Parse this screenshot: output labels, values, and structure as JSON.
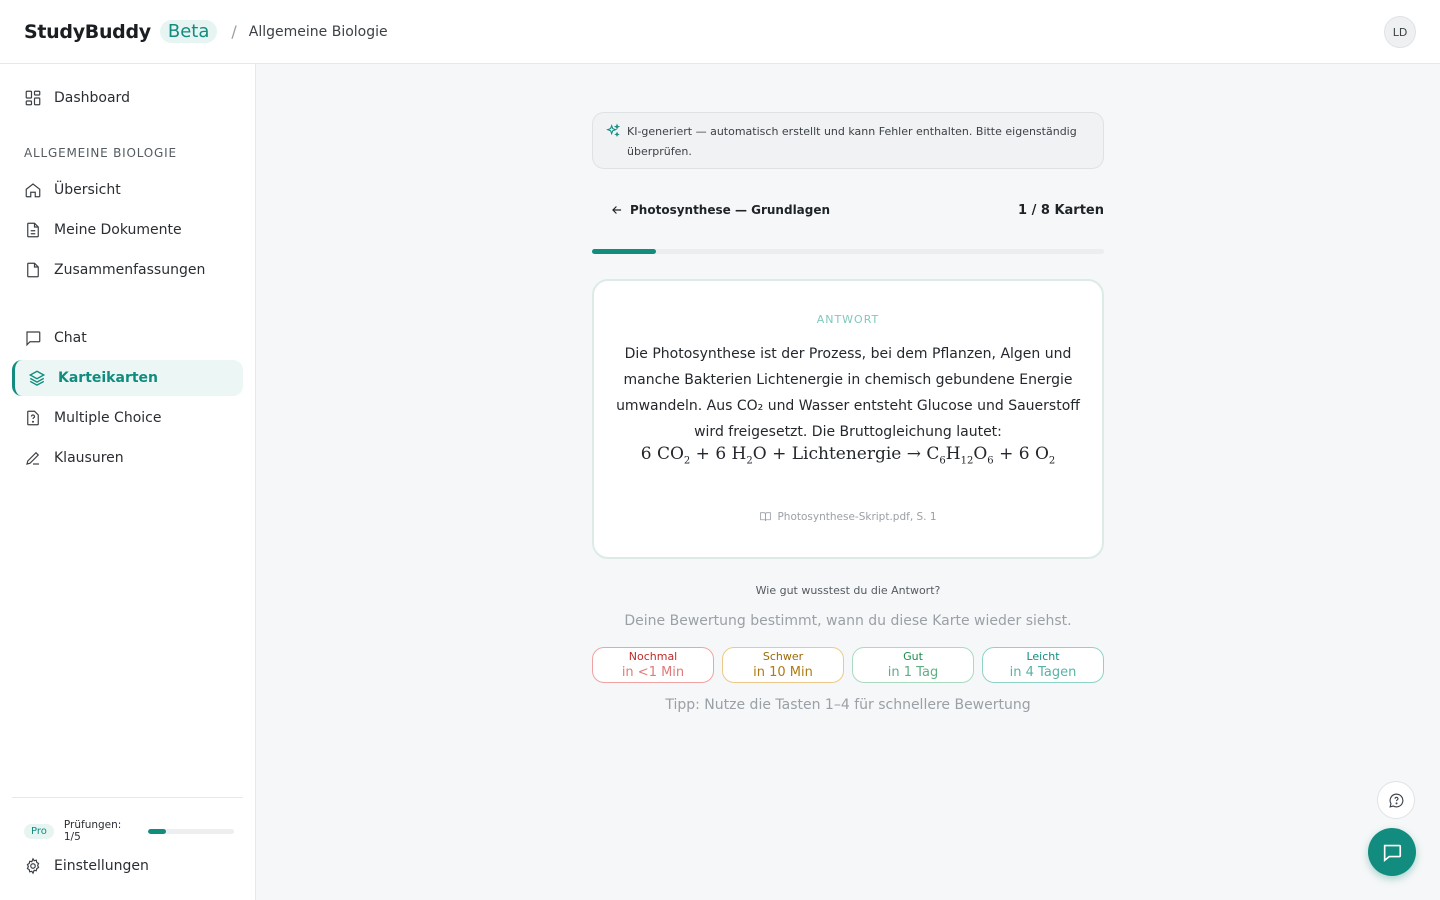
{
  "header": {
    "brand": "StudyBuddy",
    "badge": "Beta",
    "separator": "/",
    "breadcrumb": "Allgemeine Biologie",
    "avatar_initials": "LD"
  },
  "sidebar": {
    "dashboard": "Dashboard",
    "section_label": "ALLGEMEINE BIOLOGIE",
    "items": [
      {
        "label": "Übersicht",
        "icon": "home-icon"
      },
      {
        "label": "Meine Dokumente",
        "icon": "document-icon"
      },
      {
        "label": "Zusammenfassungen",
        "icon": "file-icon"
      },
      {
        "label": "Chat",
        "icon": "chat-icon"
      },
      {
        "label": "Karteikarten",
        "icon": "layers-icon",
        "active": true
      },
      {
        "label": "Multiple Choice",
        "icon": "question-icon"
      },
      {
        "label": "Klausuren",
        "icon": "pen-icon"
      }
    ],
    "plan_badge": "Pro",
    "exams_text": "Prüfungen: 1/5",
    "exams_progress": 0.2,
    "settings": "Einstellungen"
  },
  "notice": {
    "text": "KI-generiert — automatisch erstellt und kann Fehler enthalten. Bitte eigenständig überprüfen."
  },
  "deck": {
    "title": "Photosynthese — Grundlagen",
    "count": "1 / 8 Karten",
    "progress": 0.125
  },
  "card": {
    "label": "ANTWORT",
    "text": "Die Photosynthese ist der Prozess, bei dem Pflanzen, Algen und manche Bakterien Lichtenergie in chemisch gebundene Energie umwandeln. Aus CO₂ und Wasser entsteht Glucose und Sauerstoff wird freigesetzt. Die Bruttogleichung lautet:",
    "formula": {
      "part1": "6 CO",
      "sub1": "2",
      "part2": " + 6 H",
      "sub2": "2",
      "part3": "O + Lichtenergie → C",
      "sub3": "6",
      "part4": "H",
      "sub4": "12",
      "part5": "O",
      "sub5": "6",
      "part6": " + 6 O",
      "sub6": "2"
    },
    "source": "Photosynthese-Skript.pdf, S. 1"
  },
  "rating": {
    "question": "Wie gut wusstest du die Antwort?",
    "hint": "Deine Bewertung bestimmt, wann du diese Karte wieder siehst.",
    "options": [
      {
        "title": "Nochmal",
        "interval": "in <1 Min"
      },
      {
        "title": "Schwer",
        "interval": "in 10 Min"
      },
      {
        "title": "Gut",
        "interval": "in 1 Tag"
      },
      {
        "title": "Leicht",
        "interval": "in 4 Tagen"
      }
    ],
    "tip": "Tipp: Nutze die Tasten 1–4 für schnellere Bewertung"
  },
  "colors": {
    "accent": "#128c7e",
    "again": "#c22a2a",
    "hard": "#9a6a06",
    "good": "#1f8c4a",
    "easy": "#128c7e"
  }
}
